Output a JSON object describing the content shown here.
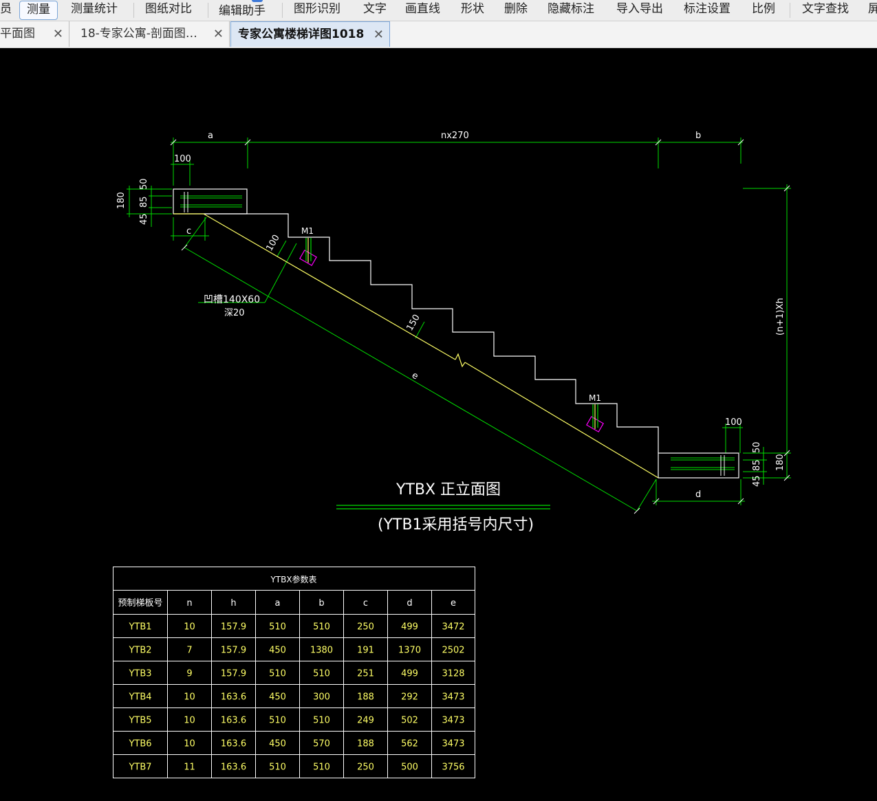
{
  "toolbar": {
    "items": [
      "员",
      "测量",
      "测量统计",
      "图纸对比",
      "编辑助手",
      "图形识别",
      "文字",
      "画直线",
      "形状",
      "删除",
      "隐藏标注",
      "导入导出",
      "标注设置",
      "比例",
      "文字查找",
      "屏"
    ]
  },
  "tabs": [
    {
      "label": "平面图",
      "close": "✕"
    },
    {
      "label": "18-专家公寓-剖面图…",
      "close": "✕"
    },
    {
      "label": "专家公寓楼梯详图1018",
      "close": "✕"
    }
  ],
  "drawing": {
    "dims": {
      "a": "a",
      "nx270": "nx270",
      "b": "b",
      "d100_left": "100",
      "d50_left": "50",
      "d180_left": "180",
      "d85_left": "85",
      "d45_left": "45",
      "c": "c",
      "d100_diag": "100",
      "m1_top": "M1",
      "groove": "凹槽140X60",
      "groove_depth": "深20",
      "d150": "150",
      "e": "e",
      "m1_bottom": "M1",
      "d100_right": "100",
      "d50_right": "50",
      "d85_right": "85",
      "d45_right": "45",
      "d180_right": "180",
      "d": "d",
      "height": "(n+1)Xh"
    },
    "title": "YTBX  正立面图",
    "subtitle": "(YTB1采用括号内尺寸)"
  },
  "table": {
    "title": "YTBX参数表",
    "headers": [
      "预制梯板号",
      "n",
      "h",
      "a",
      "b",
      "c",
      "d",
      "e"
    ],
    "rows": [
      [
        "YTB1",
        "10",
        "157.9",
        "510",
        "510",
        "250",
        "499",
        "3472"
      ],
      [
        "YTB2",
        "7",
        "157.9",
        "450",
        "1380",
        "191",
        "1370",
        "2502"
      ],
      [
        "YTB3",
        "9",
        "157.9",
        "510",
        "510",
        "251",
        "499",
        "3128"
      ],
      [
        "YTB4",
        "10",
        "163.6",
        "450",
        "300",
        "188",
        "292",
        "3473"
      ],
      [
        "YTB5",
        "10",
        "163.6",
        "510",
        "510",
        "249",
        "502",
        "3473"
      ],
      [
        "YTB6",
        "10",
        "163.6",
        "450",
        "570",
        "188",
        "562",
        "3473"
      ],
      [
        "YTB7",
        "11",
        "163.6",
        "510",
        "510",
        "250",
        "500",
        "3756"
      ]
    ]
  },
  "colors": {
    "dim": "#00e000",
    "outline": "#ffffff",
    "stair": "#ffff66",
    "embed": "#ff00ff",
    "table_text": "#ffff66",
    "table_line": "#ffffff"
  }
}
